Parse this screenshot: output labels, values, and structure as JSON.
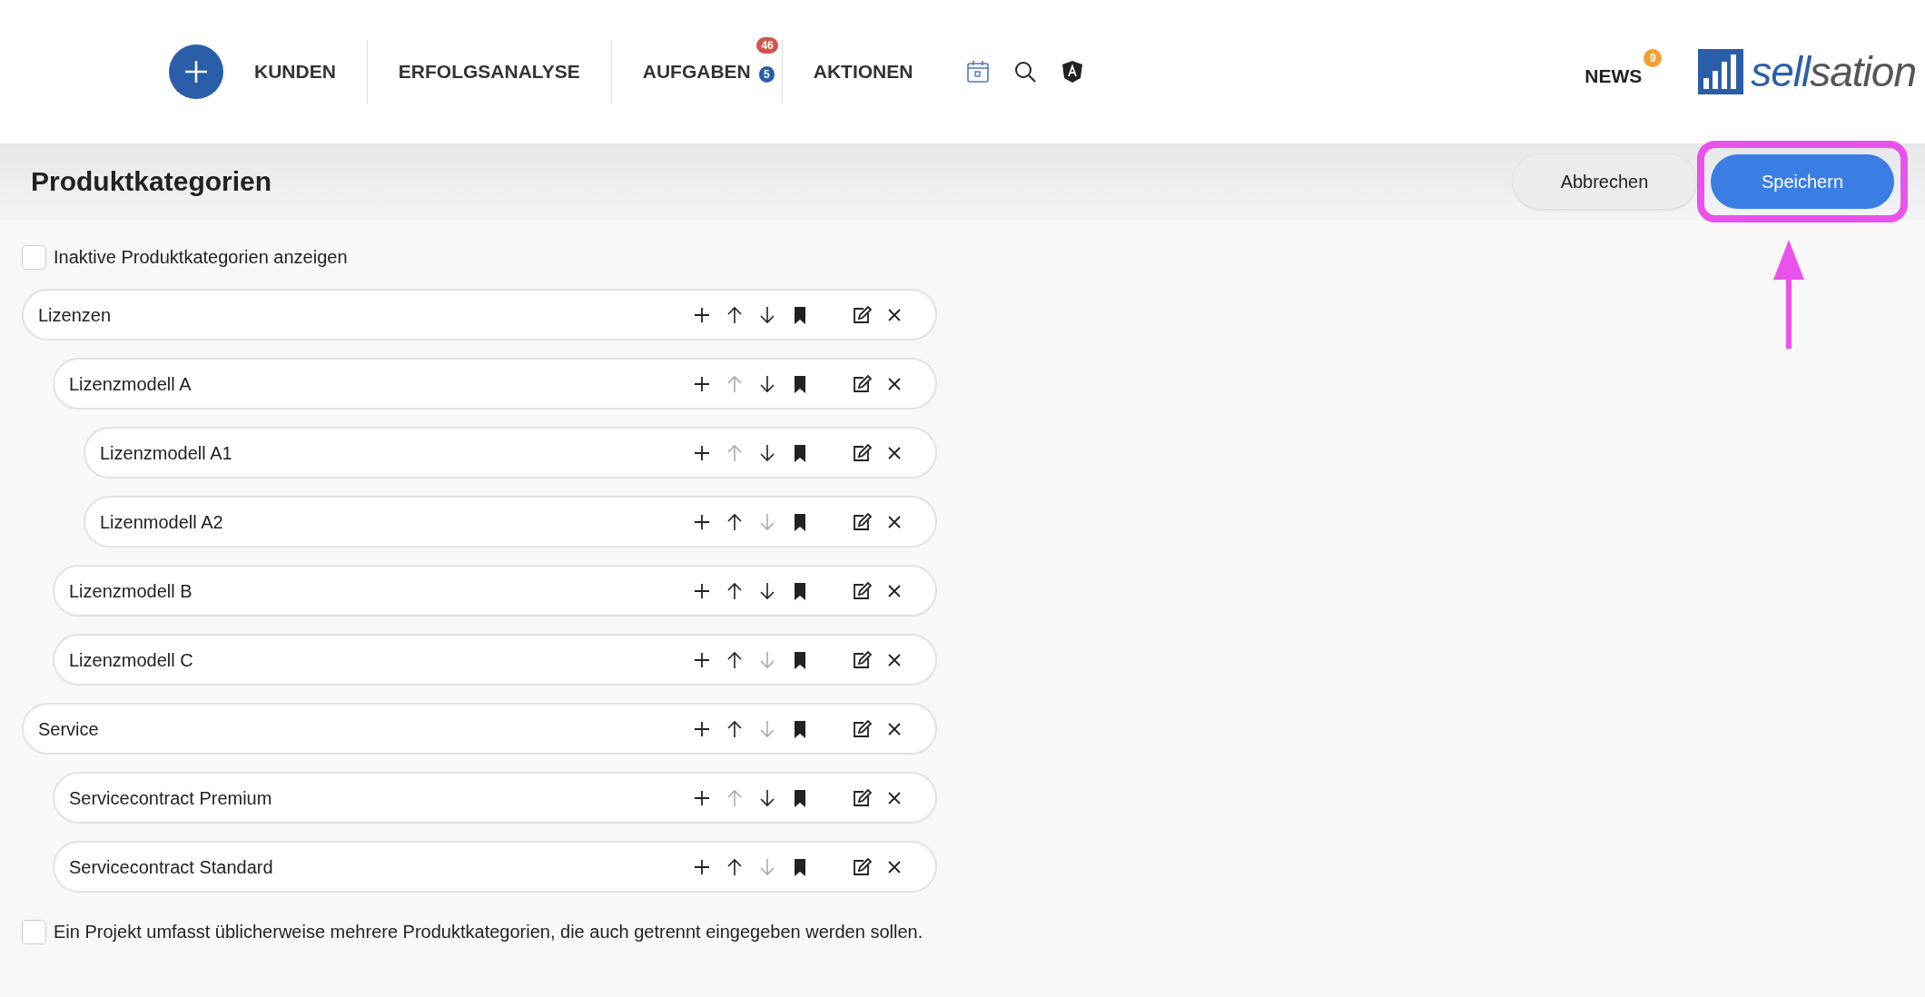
{
  "nav": {
    "items": [
      {
        "label": "KUNDEN"
      },
      {
        "label": "ERFOLGSANALYSE"
      },
      {
        "label": "AUFGABEN",
        "badges": [
          {
            "text": "46",
            "color": "#d0544a"
          },
          {
            "text": "5",
            "color": "#2a5ea8"
          }
        ]
      },
      {
        "label": "AKTIONEN"
      }
    ],
    "news": {
      "label": "NEWS",
      "badge": "9"
    },
    "logo": {
      "part_1": "sell",
      "part_2": "sation"
    }
  },
  "page": {
    "title": "Produktkategorien",
    "buttons": [
      {
        "label": "Abbrechen",
        "kind": "secondary"
      },
      {
        "label": "Speichern",
        "kind": "primary"
      }
    ]
  },
  "show_inactive": {
    "label": "Inaktive Produktkategorien anzeigen",
    "checked": false
  },
  "categories": [
    {
      "name": "Lizenzen",
      "can_move_up": true,
      "can_move_down": true,
      "children": [
        {
          "name": "Lizenzmodell A",
          "can_move_up": false,
          "can_move_down": true,
          "children": [
            {
              "name": "Lizenzmodell A1",
              "can_move_up": false,
              "can_move_down": true
            },
            {
              "name": "Lizenmodell A2",
              "can_move_up": true,
              "can_move_down": false
            }
          ]
        },
        {
          "name": "Lizenzmodell B",
          "can_move_up": true,
          "can_move_down": true
        },
        {
          "name": "Lizenzmodell C",
          "can_move_up": true,
          "can_move_down": false
        }
      ]
    },
    {
      "name": "Service",
      "can_move_up": true,
      "can_move_down": false,
      "children": [
        {
          "name": "Servicecontract Premium",
          "can_move_up": false,
          "can_move_down": true
        },
        {
          "name": "Servicecontract Standard",
          "can_move_up": true,
          "can_move_down": false
        }
      ]
    }
  ],
  "project_option": {
    "label": "Ein Projekt umfasst üblicherweise mehrere Produktkategorien, die auch getrennt eingegeben werden sollen.",
    "checked": false
  }
}
